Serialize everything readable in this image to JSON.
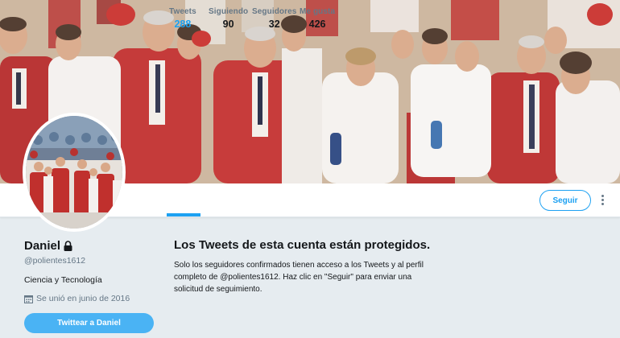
{
  "profile": {
    "name": "Daniel",
    "handle": "@polientes1612",
    "bio": "Ciencia y Tecnología",
    "joined": "Se unió en junio de 2016",
    "tweet_button": "Twittear a Daniel"
  },
  "stats": [
    {
      "label": "Tweets",
      "value": "288",
      "active": true
    },
    {
      "label": "Siguiendo",
      "value": "90",
      "active": false
    },
    {
      "label": "Seguidores",
      "value": "32",
      "active": false
    },
    {
      "label": "Me gusta",
      "value": "426",
      "active": false
    }
  ],
  "follow_button": "Seguir",
  "protected": {
    "title": "Los Tweets de esta cuenta están protegidos.",
    "body": "Solo los seguidores confirmados tienen acceso a los Tweets y al perfil completo de @polientes1612. Haz clic en \"Seguir\" para enviar una solicitud de seguimiento."
  },
  "colors": {
    "accent": "#1da1f2",
    "tweet_button": "#4ab3f4",
    "background": "#e6ecf0",
    "secondary_text": "#657786"
  },
  "icons": [
    "lock-icon",
    "calendar-icon",
    "more-icon"
  ]
}
